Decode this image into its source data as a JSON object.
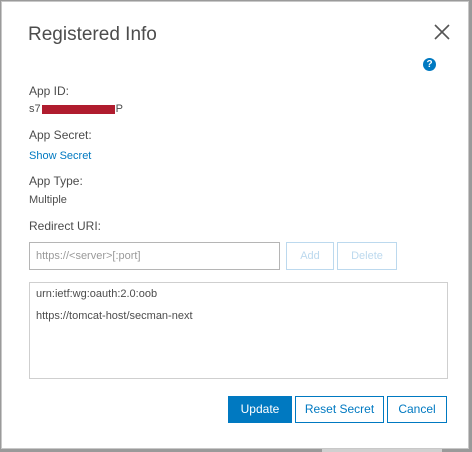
{
  "dialog": {
    "title": "Registered Info",
    "help_icon": "question-circle-icon",
    "close_icon": "close-icon"
  },
  "app_id": {
    "label": "App ID:",
    "value_prefix": "s7",
    "value_suffix": "P"
  },
  "app_secret": {
    "label": "App Secret:",
    "link": "Show Secret"
  },
  "app_type": {
    "label": "App Type:",
    "value": "Multiple"
  },
  "redirect_uri": {
    "label": "Redirect URI:",
    "input_value": "",
    "placeholder": "https://<server>[:port]",
    "add_label": "Add",
    "delete_label": "Delete",
    "items": [
      "urn:ietf:wg:oauth:2.0:oob",
      "https://tomcat-host/secman-next"
    ]
  },
  "footer": {
    "update_label": "Update",
    "reset_label": "Reset Secret",
    "cancel_label": "Cancel"
  },
  "colors": {
    "accent": "#0079c1",
    "redaction": "#b01c2e"
  }
}
